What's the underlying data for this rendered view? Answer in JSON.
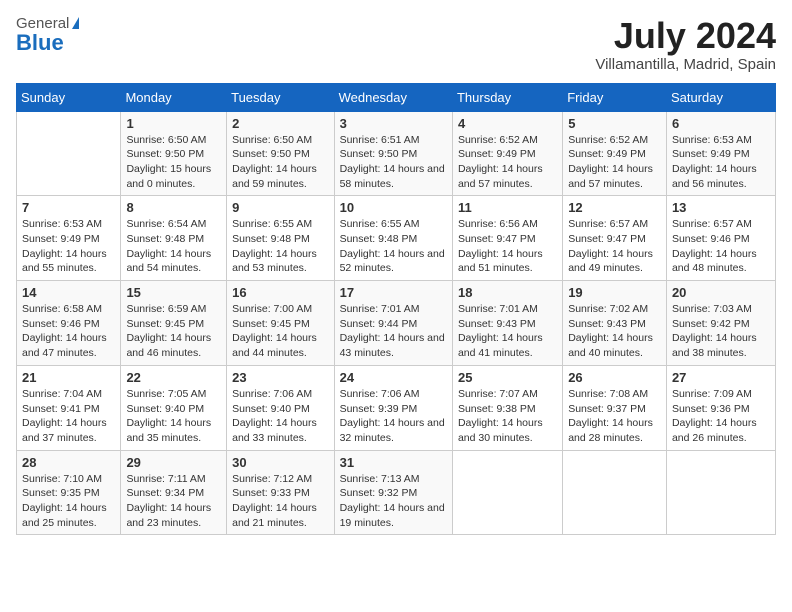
{
  "header": {
    "logo_general": "General",
    "logo_blue": "Blue",
    "month": "July 2024",
    "location": "Villamantilla, Madrid, Spain"
  },
  "columns": [
    "Sunday",
    "Monday",
    "Tuesday",
    "Wednesday",
    "Thursday",
    "Friday",
    "Saturday"
  ],
  "weeks": [
    [
      {
        "day": "",
        "sunrise": "",
        "sunset": "",
        "daylight": ""
      },
      {
        "day": "1",
        "sunrise": "Sunrise: 6:50 AM",
        "sunset": "Sunset: 9:50 PM",
        "daylight": "Daylight: 15 hours and 0 minutes."
      },
      {
        "day": "2",
        "sunrise": "Sunrise: 6:50 AM",
        "sunset": "Sunset: 9:50 PM",
        "daylight": "Daylight: 14 hours and 59 minutes."
      },
      {
        "day": "3",
        "sunrise": "Sunrise: 6:51 AM",
        "sunset": "Sunset: 9:50 PM",
        "daylight": "Daylight: 14 hours and 58 minutes."
      },
      {
        "day": "4",
        "sunrise": "Sunrise: 6:52 AM",
        "sunset": "Sunset: 9:49 PM",
        "daylight": "Daylight: 14 hours and 57 minutes."
      },
      {
        "day": "5",
        "sunrise": "Sunrise: 6:52 AM",
        "sunset": "Sunset: 9:49 PM",
        "daylight": "Daylight: 14 hours and 57 minutes."
      },
      {
        "day": "6",
        "sunrise": "Sunrise: 6:53 AM",
        "sunset": "Sunset: 9:49 PM",
        "daylight": "Daylight: 14 hours and 56 minutes."
      }
    ],
    [
      {
        "day": "7",
        "sunrise": "Sunrise: 6:53 AM",
        "sunset": "Sunset: 9:49 PM",
        "daylight": "Daylight: 14 hours and 55 minutes."
      },
      {
        "day": "8",
        "sunrise": "Sunrise: 6:54 AM",
        "sunset": "Sunset: 9:48 PM",
        "daylight": "Daylight: 14 hours and 54 minutes."
      },
      {
        "day": "9",
        "sunrise": "Sunrise: 6:55 AM",
        "sunset": "Sunset: 9:48 PM",
        "daylight": "Daylight: 14 hours and 53 minutes."
      },
      {
        "day": "10",
        "sunrise": "Sunrise: 6:55 AM",
        "sunset": "Sunset: 9:48 PM",
        "daylight": "Daylight: 14 hours and 52 minutes."
      },
      {
        "day": "11",
        "sunrise": "Sunrise: 6:56 AM",
        "sunset": "Sunset: 9:47 PM",
        "daylight": "Daylight: 14 hours and 51 minutes."
      },
      {
        "day": "12",
        "sunrise": "Sunrise: 6:57 AM",
        "sunset": "Sunset: 9:47 PM",
        "daylight": "Daylight: 14 hours and 49 minutes."
      },
      {
        "day": "13",
        "sunrise": "Sunrise: 6:57 AM",
        "sunset": "Sunset: 9:46 PM",
        "daylight": "Daylight: 14 hours and 48 minutes."
      }
    ],
    [
      {
        "day": "14",
        "sunrise": "Sunrise: 6:58 AM",
        "sunset": "Sunset: 9:46 PM",
        "daylight": "Daylight: 14 hours and 47 minutes."
      },
      {
        "day": "15",
        "sunrise": "Sunrise: 6:59 AM",
        "sunset": "Sunset: 9:45 PM",
        "daylight": "Daylight: 14 hours and 46 minutes."
      },
      {
        "day": "16",
        "sunrise": "Sunrise: 7:00 AM",
        "sunset": "Sunset: 9:45 PM",
        "daylight": "Daylight: 14 hours and 44 minutes."
      },
      {
        "day": "17",
        "sunrise": "Sunrise: 7:01 AM",
        "sunset": "Sunset: 9:44 PM",
        "daylight": "Daylight: 14 hours and 43 minutes."
      },
      {
        "day": "18",
        "sunrise": "Sunrise: 7:01 AM",
        "sunset": "Sunset: 9:43 PM",
        "daylight": "Daylight: 14 hours and 41 minutes."
      },
      {
        "day": "19",
        "sunrise": "Sunrise: 7:02 AM",
        "sunset": "Sunset: 9:43 PM",
        "daylight": "Daylight: 14 hours and 40 minutes."
      },
      {
        "day": "20",
        "sunrise": "Sunrise: 7:03 AM",
        "sunset": "Sunset: 9:42 PM",
        "daylight": "Daylight: 14 hours and 38 minutes."
      }
    ],
    [
      {
        "day": "21",
        "sunrise": "Sunrise: 7:04 AM",
        "sunset": "Sunset: 9:41 PM",
        "daylight": "Daylight: 14 hours and 37 minutes."
      },
      {
        "day": "22",
        "sunrise": "Sunrise: 7:05 AM",
        "sunset": "Sunset: 9:40 PM",
        "daylight": "Daylight: 14 hours and 35 minutes."
      },
      {
        "day": "23",
        "sunrise": "Sunrise: 7:06 AM",
        "sunset": "Sunset: 9:40 PM",
        "daylight": "Daylight: 14 hours and 33 minutes."
      },
      {
        "day": "24",
        "sunrise": "Sunrise: 7:06 AM",
        "sunset": "Sunset: 9:39 PM",
        "daylight": "Daylight: 14 hours and 32 minutes."
      },
      {
        "day": "25",
        "sunrise": "Sunrise: 7:07 AM",
        "sunset": "Sunset: 9:38 PM",
        "daylight": "Daylight: 14 hours and 30 minutes."
      },
      {
        "day": "26",
        "sunrise": "Sunrise: 7:08 AM",
        "sunset": "Sunset: 9:37 PM",
        "daylight": "Daylight: 14 hours and 28 minutes."
      },
      {
        "day": "27",
        "sunrise": "Sunrise: 7:09 AM",
        "sunset": "Sunset: 9:36 PM",
        "daylight": "Daylight: 14 hours and 26 minutes."
      }
    ],
    [
      {
        "day": "28",
        "sunrise": "Sunrise: 7:10 AM",
        "sunset": "Sunset: 9:35 PM",
        "daylight": "Daylight: 14 hours and 25 minutes."
      },
      {
        "day": "29",
        "sunrise": "Sunrise: 7:11 AM",
        "sunset": "Sunset: 9:34 PM",
        "daylight": "Daylight: 14 hours and 23 minutes."
      },
      {
        "day": "30",
        "sunrise": "Sunrise: 7:12 AM",
        "sunset": "Sunset: 9:33 PM",
        "daylight": "Daylight: 14 hours and 21 minutes."
      },
      {
        "day": "31",
        "sunrise": "Sunrise: 7:13 AM",
        "sunset": "Sunset: 9:32 PM",
        "daylight": "Daylight: 14 hours and 19 minutes."
      },
      {
        "day": "",
        "sunrise": "",
        "sunset": "",
        "daylight": ""
      },
      {
        "day": "",
        "sunrise": "",
        "sunset": "",
        "daylight": ""
      },
      {
        "day": "",
        "sunrise": "",
        "sunset": "",
        "daylight": ""
      }
    ]
  ]
}
